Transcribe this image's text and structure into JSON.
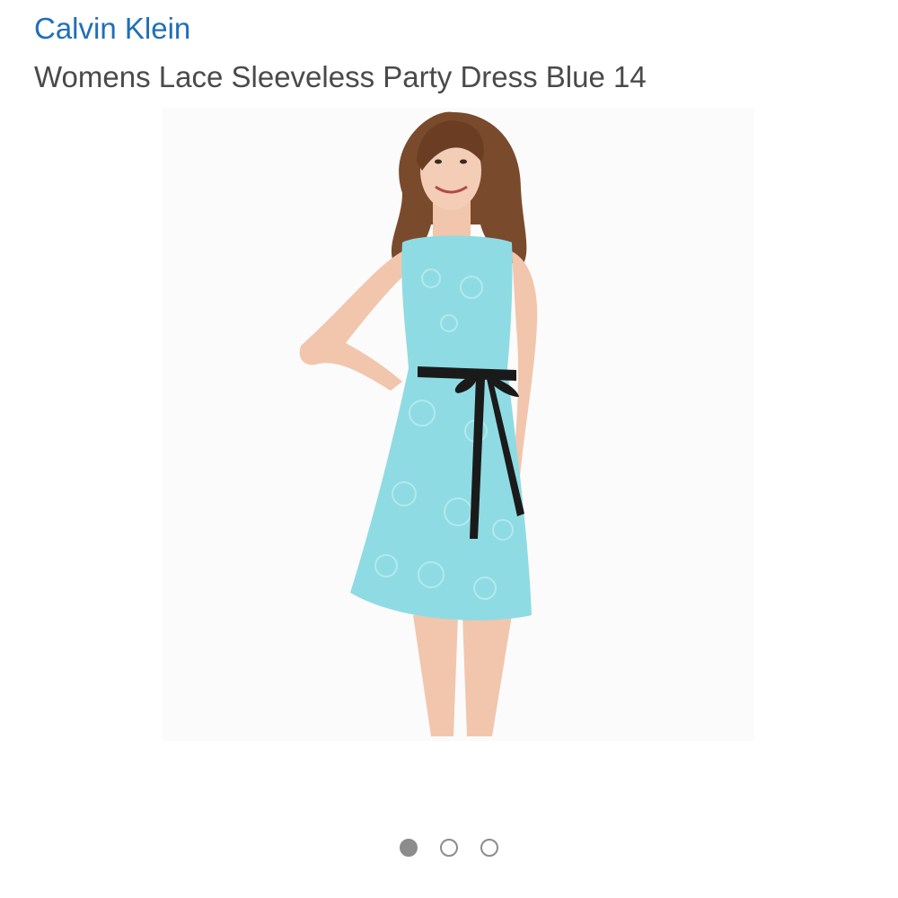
{
  "product": {
    "brand": "Calvin Klein",
    "title": "Womens Lace Sleeveless Party Dress Blue 14"
  },
  "gallery": {
    "image_description_icon": "dress-photo",
    "dress_color": "#8fdbe3",
    "sash_color": "#1a1a1a",
    "pagination": {
      "count": 3,
      "active_index": 0
    }
  },
  "colors": {
    "brand_link": "#1f6fb8",
    "title_text": "#4a4a4a",
    "dot": "#8c8c8c"
  }
}
